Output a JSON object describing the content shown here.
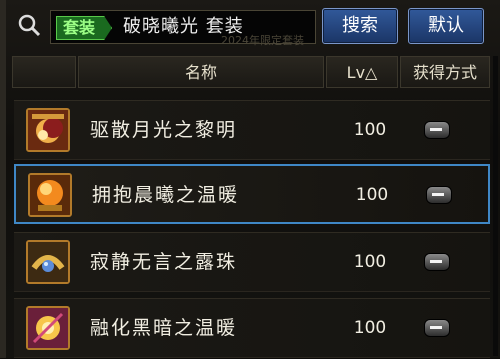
{
  "search": {
    "tag": "套装",
    "query": "破晓曦光  套装",
    "background_hint": "2024年限定套装",
    "search_button": "搜索",
    "default_button": "默认"
  },
  "table": {
    "headers": {
      "name": "名称",
      "level": "Lv△",
      "source": "获得方式"
    },
    "rows": [
      {
        "name": "驱散月光之黎明",
        "level": "100",
        "icon": "moon-sun-icon",
        "selected": false
      },
      {
        "name": "拥抱晨曦之温暖",
        "level": "100",
        "icon": "sun-orb-icon",
        "selected": true
      },
      {
        "name": "寂静无言之露珠",
        "level": "100",
        "icon": "dewdrop-belt-icon",
        "selected": false
      },
      {
        "name": "融化黑暗之温暖",
        "level": "100",
        "icon": "glow-orb-icon",
        "selected": false
      }
    ]
  },
  "colors": {
    "accent_blue": "#3f87c6",
    "tag_green": "#58c94a",
    "text": "#f1eee2"
  }
}
